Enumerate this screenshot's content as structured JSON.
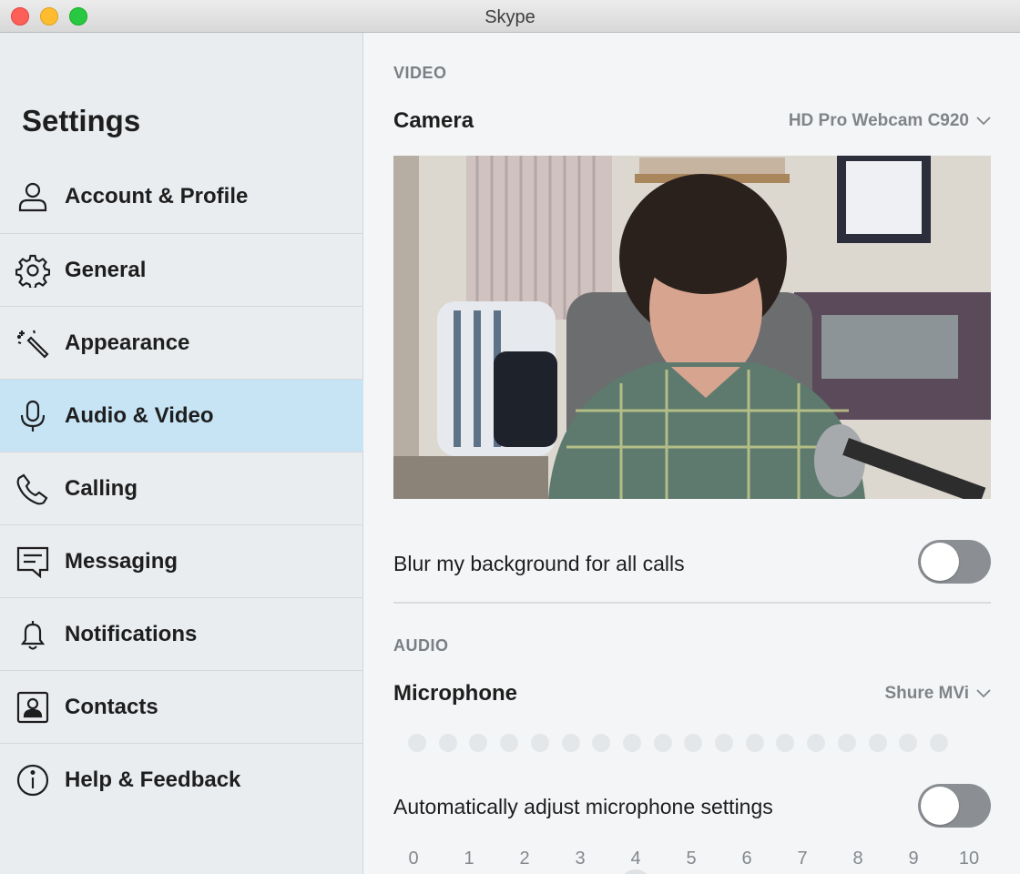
{
  "window": {
    "title": "Skype"
  },
  "sidebar": {
    "title": "Settings",
    "items": [
      {
        "label": "Account & Profile",
        "icon": "person-icon"
      },
      {
        "label": "General",
        "icon": "gear-icon"
      },
      {
        "label": "Appearance",
        "icon": "magic-wand-icon"
      },
      {
        "label": "Audio & Video",
        "icon": "microphone-icon",
        "active": true
      },
      {
        "label": "Calling",
        "icon": "phone-icon"
      },
      {
        "label": "Messaging",
        "icon": "message-icon"
      },
      {
        "label": "Notifications",
        "icon": "bell-icon"
      },
      {
        "label": "Contacts",
        "icon": "contact-card-icon"
      },
      {
        "label": "Help & Feedback",
        "icon": "info-icon"
      }
    ]
  },
  "video": {
    "section_label": "VIDEO",
    "camera_label": "Camera",
    "camera_device": "HD Pro Webcam C920",
    "blur_label": "Blur my background for all calls",
    "blur_on": false
  },
  "audio": {
    "section_label": "AUDIO",
    "microphone_label": "Microphone",
    "microphone_device": "Shure MVi",
    "auto_adjust_label": "Automatically adjust microphone settings",
    "auto_adjust_on": false,
    "volume_scale": [
      "0",
      "1",
      "2",
      "3",
      "4",
      "5",
      "6",
      "7",
      "8",
      "9",
      "10"
    ],
    "volume_value": 4
  },
  "colors": {
    "active_nav": "#c7e4f5",
    "toggle_off": "#8b8f94"
  }
}
